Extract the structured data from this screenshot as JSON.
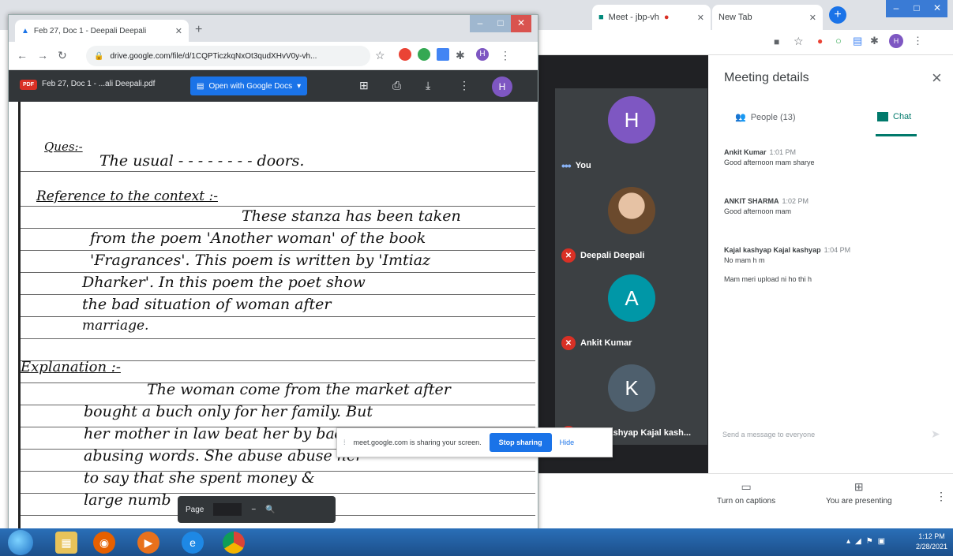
{
  "background_window": {
    "tabs": [
      {
        "label": "Meet - jbp-vh",
        "active": false
      },
      {
        "label": "New Tab",
        "active": false
      }
    ],
    "meet": {
      "tiles": [
        {
          "initial": "H",
          "name": "You",
          "color": "#7e57c2",
          "muted": false
        },
        {
          "initial": "",
          "name": "Deepali Deepali",
          "color": "#7a5a3a",
          "muted": true
        },
        {
          "initial": "A",
          "name": "Ankit Kumar",
          "color": "#0097a7",
          "muted": true
        },
        {
          "initial": "K",
          "name": "Kajal kashyap Kajal kash...",
          "color": "#4e5f6d",
          "muted": true
        }
      ]
    },
    "panel": {
      "title": "Meeting details",
      "tabs": {
        "people": "People (13)",
        "chat": "Chat"
      },
      "messages": [
        {
          "sender": "Ankit Kumar",
          "time": "1:01 PM",
          "lines": [
            "Good afternoon mam sharye"
          ]
        },
        {
          "sender": "ANKIT SHARMA",
          "time": "1:02 PM",
          "lines": [
            "Good afternoon mam"
          ]
        },
        {
          "sender": "Kajal kashyap Kajal kashyap",
          "time": "1:04 PM",
          "lines": [
            "No mam h m",
            "Mam meri upload ni ho thi h"
          ]
        }
      ],
      "input_placeholder": "Send a message to everyone"
    },
    "bottom_bar": {
      "captions": "Turn on captions",
      "presenting": "You are presenting"
    }
  },
  "front_window": {
    "tab_title": "Feb 27, Doc 1 - Deepali Deepali",
    "url": "drive.google.com/file/d/1CQPTiczkqNxOt3qudXHvV0y-vh...",
    "viewer": {
      "file_name": "Feb 27, Doc 1 - ...ali Deepali.pdf",
      "pdf_badge": "PDF",
      "open_with": "Open with Google Docs",
      "avatar": "H"
    },
    "handwriting": {
      "q_label": "Ques:-",
      "q_line": "The usual - - - - - - - - doors.",
      "ref_heading": "Reference to the context :-",
      "ref_lines": [
        "These stanza has been taken",
        "from the poem 'Another woman' of the book",
        "'Fragrances'. This poem is written by 'Imtiaz",
        "Dharker'. In this poem the poet show",
        "the bad situation of woman after",
        "marriage."
      ],
      "exp_heading": "Explanation :-",
      "exp_lines": [
        "The woman come from the market after",
        "bought a buch only for her family. But",
        "her mother in law beat her by bad",
        "abusing words. She abuse abuse her",
        "to say that she spent money &",
        "large numb"
      ]
    },
    "page_toolbar": {
      "page_label": "Page"
    },
    "share_bar": {
      "message": "meet.google.com is sharing your screen.",
      "stop": "Stop sharing",
      "hide": "Hide"
    }
  },
  "taskbar": {
    "time": "1:12 PM",
    "date": "2/28/2021"
  }
}
